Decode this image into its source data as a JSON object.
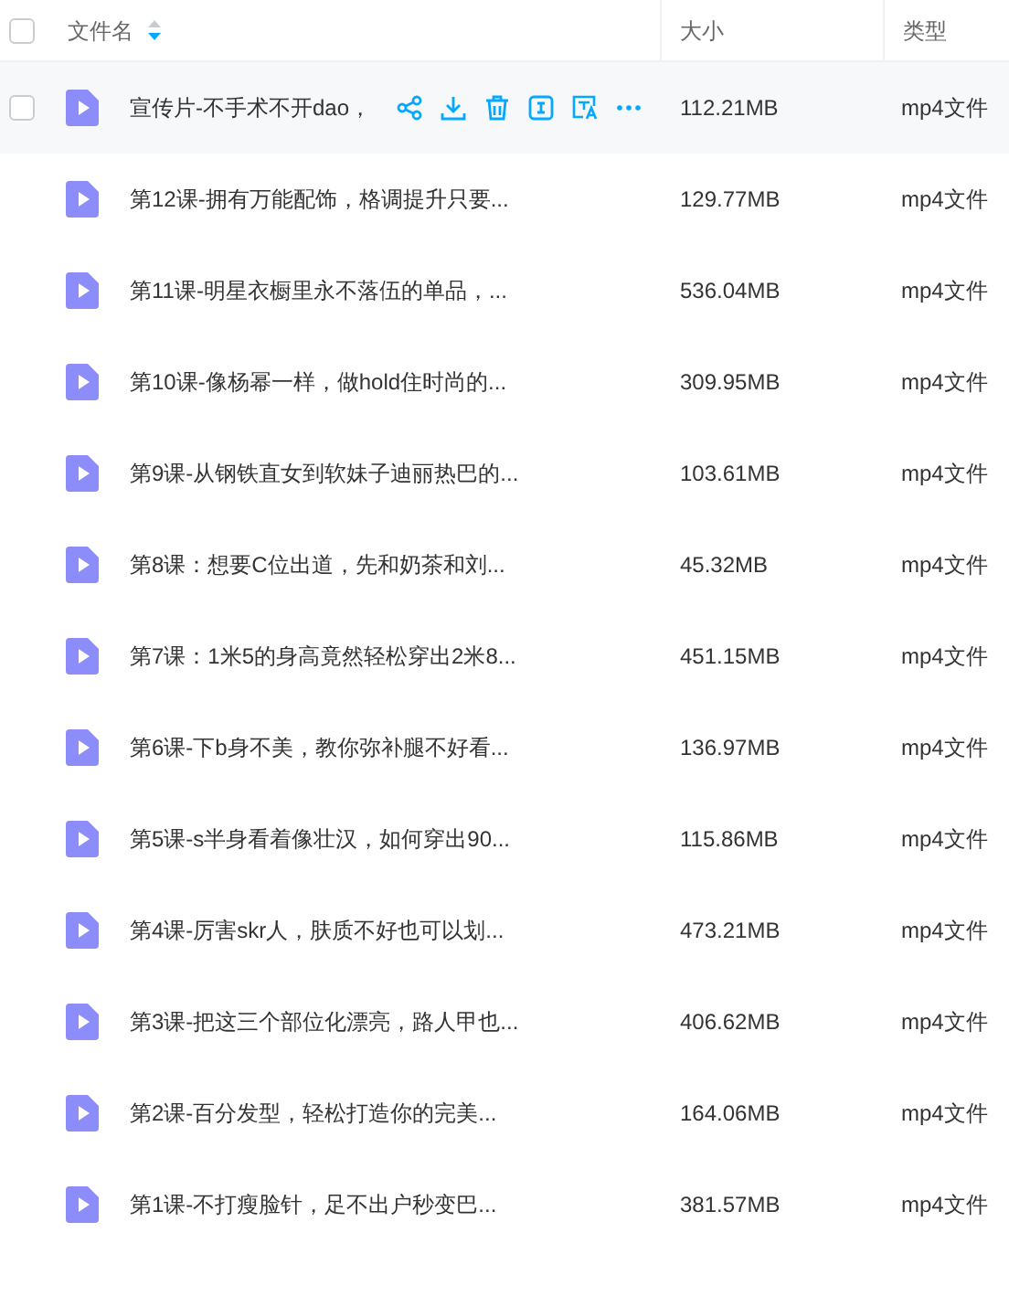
{
  "table": {
    "select_all": {
      "checked": false
    },
    "columns": [
      {
        "label": "文件名",
        "sortable": true
      },
      {
        "label": "大小",
        "sortable": false
      },
      {
        "label": "类型",
        "sortable": false
      }
    ],
    "rows": [
      {
        "name": "宣传片-不手术不开dao，",
        "size": "112.21MB",
        "type": "mp4文件",
        "hovered": true,
        "checked": false
      },
      {
        "name": "第12课-拥有万能配饰，格调提升只要...",
        "size": "129.77MB",
        "type": "mp4文件",
        "hovered": false,
        "checked": false
      },
      {
        "name": "第11课-明星衣橱里永不落伍的单品，...",
        "size": "536.04MB",
        "type": "mp4文件",
        "hovered": false,
        "checked": false
      },
      {
        "name": "第10课-像杨幂一样，做hold住时尚的...",
        "size": "309.95MB",
        "type": "mp4文件",
        "hovered": false,
        "checked": false
      },
      {
        "name": "第9课-从钢铁直女到软妹子迪丽热巴的...",
        "size": "103.61MB",
        "type": "mp4文件",
        "hovered": false,
        "checked": false
      },
      {
        "name": "第8课：想要C位出道，先和奶茶和刘...",
        "size": "45.32MB",
        "type": "mp4文件",
        "hovered": false,
        "checked": false
      },
      {
        "name": "第7课：1米5的身高竟然轻松穿出2米8...",
        "size": "451.15MB",
        "type": "mp4文件",
        "hovered": false,
        "checked": false
      },
      {
        "name": "第6课-下b身不美，教你弥补腿不好看...",
        "size": "136.97MB",
        "type": "mp4文件",
        "hovered": false,
        "checked": false
      },
      {
        "name": "第5课-s半身看着像壮汉，如何穿出90...",
        "size": "115.86MB",
        "type": "mp4文件",
        "hovered": false,
        "checked": false
      },
      {
        "name": "第4课-厉害skr人，肤质不好也可以划...",
        "size": "473.21MB",
        "type": "mp4文件",
        "hovered": false,
        "checked": false
      },
      {
        "name": "第3课-把这三个部位化漂亮，路人甲也...",
        "size": "406.62MB",
        "type": "mp4文件",
        "hovered": false,
        "checked": false
      },
      {
        "name": "第2课-百分发型，轻松打造你的完美...",
        "size": "164.06MB",
        "type": "mp4文件",
        "hovered": false,
        "checked": false
      },
      {
        "name": "第1课-不打瘦脸针，足不出户秒变巴...",
        "size": "381.57MB",
        "type": "mp4文件",
        "hovered": false,
        "checked": false
      }
    ]
  }
}
